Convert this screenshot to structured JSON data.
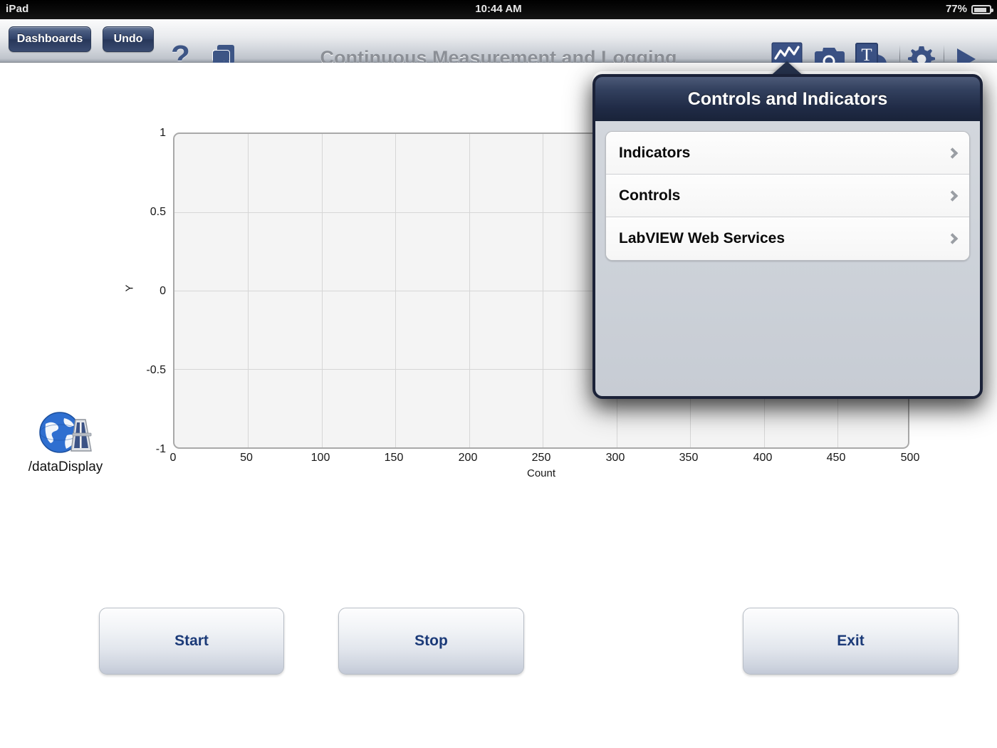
{
  "status_bar": {
    "device": "iPad",
    "time": "10:44 AM",
    "battery_percent": "77%",
    "battery_icon": "battery-icon"
  },
  "toolbar": {
    "dashboards_label": "Dashboards",
    "undo_label": "Undo",
    "help_glyph": "?",
    "duplicate_icon": "duplicate-pages-icon",
    "title": "Continuous Measurement and Logging",
    "right_icons": [
      {
        "name": "chart-indicator-icon",
        "label": "Controls and Indicators",
        "active": true
      },
      {
        "name": "camera-icon",
        "label": "Camera"
      },
      {
        "name": "text-shape-icon",
        "label": "Text and Shapes"
      },
      {
        "name": "gear-icon",
        "label": "Settings"
      },
      {
        "name": "play-icon",
        "label": "Run"
      }
    ]
  },
  "web_service": {
    "icon": "globe-device-icon",
    "label": "/dataDisplay"
  },
  "buttons": {
    "start": "Start",
    "stop": "Stop",
    "exit": "Exit"
  },
  "popover": {
    "title": "Controls and Indicators",
    "rows": [
      {
        "label": "Indicators"
      },
      {
        "label": "Controls"
      },
      {
        "label": "LabVIEW Web Services"
      }
    ]
  },
  "chart_data": {
    "type": "line",
    "title": "",
    "xlabel": "Count",
    "ylabel": "Y",
    "xlim": [
      0,
      500
    ],
    "ylim": [
      -1,
      1
    ],
    "x_ticks": [
      0,
      50,
      100,
      150,
      200,
      250,
      300,
      350,
      400,
      450,
      500
    ],
    "y_ticks": [
      1,
      0.5,
      0,
      -0.5,
      -1
    ],
    "x_tick_labels": [
      "0",
      "50",
      "100",
      "150",
      "200",
      "250",
      "300",
      "350",
      "400",
      "450",
      "500"
    ],
    "y_tick_labels": [
      "1",
      "0.5",
      "0",
      "-0.5",
      "-1"
    ],
    "grid": true,
    "legend": false,
    "series": [
      {
        "name": "Y",
        "x": [],
        "values": []
      }
    ],
    "note": "empty plot - no data plotted",
    "plot_bg": "#f4f4f4",
    "grid_color": "#d6d6d6",
    "border_color": "#a9a9a9"
  },
  "colors": {
    "accent_navy": "#1b3a78",
    "toolbar_button": "#2f4168",
    "popover_header": "#202b46",
    "title_gray": "#8b8f96",
    "icon_blue": "#3d5585"
  }
}
